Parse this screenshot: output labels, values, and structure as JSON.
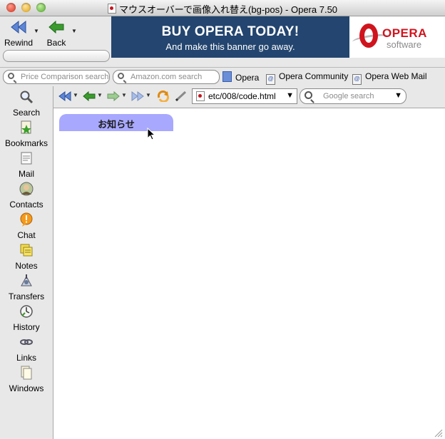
{
  "window": {
    "title": "マウスオーバーで画像入れ替え(bg-pos) - Opera 7.50"
  },
  "toolbar": {
    "rewind_label": "Rewind",
    "back_label": "Back"
  },
  "banner": {
    "headline": "BUY OPERA TODAY!",
    "subline": "And make this banner go away.",
    "logo_word": "OPERA",
    "logo_sub": "software"
  },
  "personal_bar": {
    "price_placeholder": "Price Comparison search",
    "amazon_placeholder": "Amazon.com search",
    "links": [
      "Opera",
      "Opera Community",
      "Opera Web Mail"
    ]
  },
  "panel": {
    "items": [
      {
        "label": "Search",
        "icon": "search-icon"
      },
      {
        "label": "Bookmarks",
        "icon": "bookmarks-icon"
      },
      {
        "label": "Mail",
        "icon": "mail-icon"
      },
      {
        "label": "Contacts",
        "icon": "contacts-icon"
      },
      {
        "label": "Chat",
        "icon": "chat-icon"
      },
      {
        "label": "Notes",
        "icon": "notes-icon"
      },
      {
        "label": "Transfers",
        "icon": "transfers-icon"
      },
      {
        "label": "History",
        "icon": "history-icon"
      },
      {
        "label": "Links",
        "icon": "links-icon"
      },
      {
        "label": "Windows",
        "icon": "windows-icon"
      }
    ]
  },
  "navbar": {
    "address": "etc/008/code.html",
    "google_placeholder": "Google search"
  },
  "content": {
    "notice_label": "お知らせ"
  },
  "colors": {
    "banner_bg": "#23456f",
    "opera_red": "#d0141e",
    "notice_tab": "#a8a8ff",
    "nav_blue": "#5f86d6",
    "nav_green": "#3b9b2e"
  }
}
